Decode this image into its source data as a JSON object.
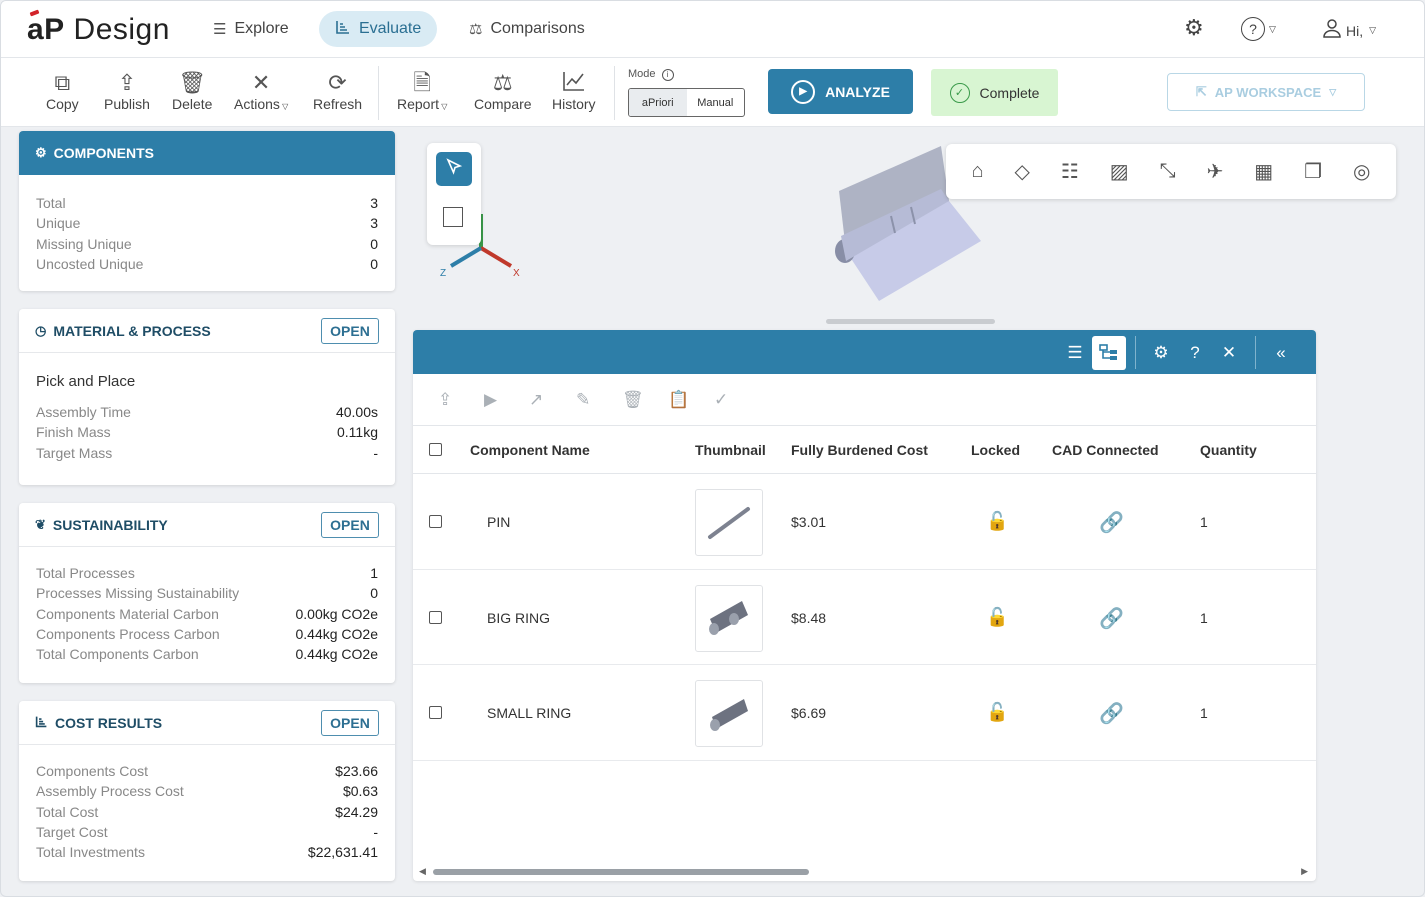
{
  "brand": {
    "mark": "aP",
    "name": "Design"
  },
  "nav": {
    "tabs": [
      {
        "label": "Explore",
        "icon": "list-icon"
      },
      {
        "label": "Evaluate",
        "icon": "chart-icon"
      },
      {
        "label": "Comparisons",
        "icon": "scale-icon"
      }
    ],
    "user_greeting": "Hi,"
  },
  "toolbar": {
    "copy": "Copy",
    "publish": "Publish",
    "delete": "Delete",
    "actions": "Actions",
    "refresh": "Refresh",
    "report": "Report",
    "compare": "Compare",
    "history": "History",
    "mode_label": "Mode",
    "mode_options": [
      "aPriori",
      "Manual"
    ],
    "mode_selected": "aPriori",
    "analyze": "ANALYZE",
    "status": "Complete",
    "workspace": "AP WORKSPACE"
  },
  "components": {
    "title": "COMPONENTS",
    "rows": [
      {
        "label": "Total",
        "value": "3"
      },
      {
        "label": "Unique",
        "value": "3"
      },
      {
        "label": "Missing Unique",
        "value": "0"
      },
      {
        "label": "Uncosted Unique",
        "value": "0"
      }
    ]
  },
  "material": {
    "title": "MATERIAL & PROCESS",
    "open": "OPEN",
    "process": "Pick and Place",
    "rows": [
      {
        "label": "Assembly Time",
        "value": "40.00s"
      },
      {
        "label": "Finish Mass",
        "value": "0.11kg"
      },
      {
        "label": "Target Mass",
        "value": "-"
      }
    ]
  },
  "sustainability": {
    "title": "SUSTAINABILITY",
    "open": "OPEN",
    "rows": [
      {
        "label": "Total Processes",
        "value": "1"
      },
      {
        "label": "Processes Missing Sustainability",
        "value": "0"
      },
      {
        "label": "Components Material Carbon",
        "value": "0.00kg CO2e"
      },
      {
        "label": "Components Process Carbon",
        "value": "0.44kg CO2e"
      },
      {
        "label": "Total Components Carbon",
        "value": "0.44kg CO2e"
      }
    ]
  },
  "cost": {
    "title": "COST RESULTS",
    "open": "OPEN",
    "rows": [
      {
        "label": "Components Cost",
        "value": "$23.66"
      },
      {
        "label": "Assembly Process Cost",
        "value": "$0.63"
      },
      {
        "label": "Total Cost",
        "value": "$24.29"
      },
      {
        "label": "Target Cost",
        "value": "-"
      },
      {
        "label": "Total Investments",
        "value": "$22,631.41"
      }
    ]
  },
  "viewer": {
    "axis_x": "X",
    "axis_z": "Z"
  },
  "table": {
    "headers": {
      "name": "Component Name",
      "thumbnail": "Thumbnail",
      "cost": "Fully Burdened Cost",
      "locked": "Locked",
      "cad": "CAD Connected",
      "quantity": "Quantity"
    },
    "rows": [
      {
        "name": "PIN",
        "cost": "$3.01",
        "quantity": "1"
      },
      {
        "name": "BIG RING",
        "cost": "$8.48",
        "quantity": "1"
      },
      {
        "name": "SMALL RING",
        "cost": "$6.69",
        "quantity": "1"
      }
    ]
  },
  "colors": {
    "primary": "#2d7ea8",
    "success_bg": "#d8f5d2",
    "link_green": "#2a9a4a"
  }
}
